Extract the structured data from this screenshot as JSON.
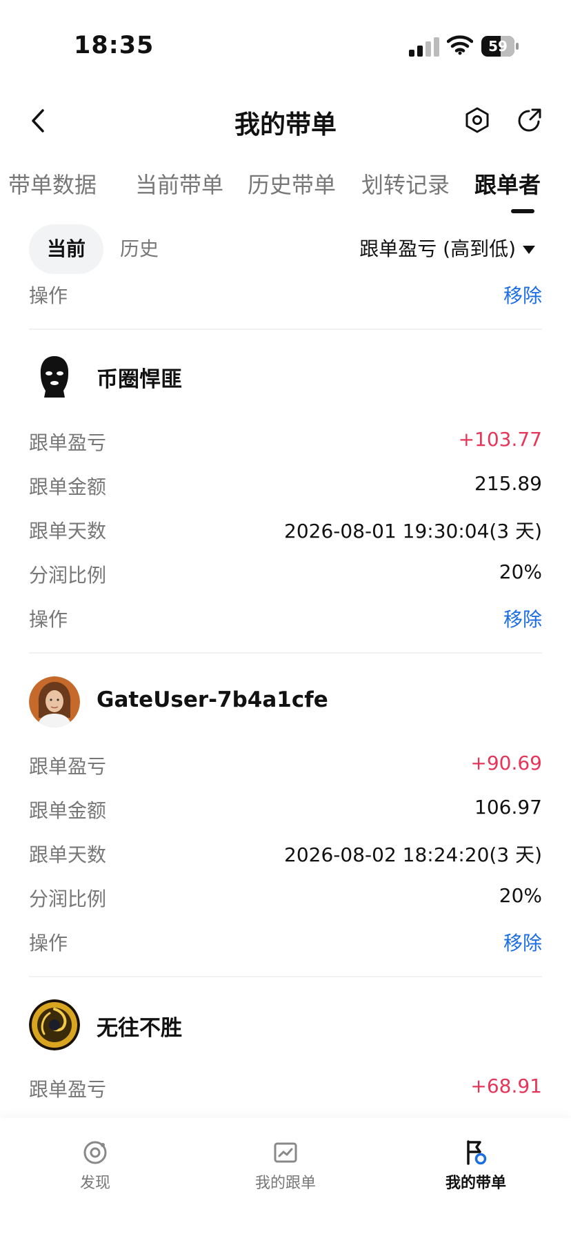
{
  "status_bar": {
    "time": "18:35",
    "battery": "59",
    "battery_level": 0.59
  },
  "header": {
    "title": "我的带单"
  },
  "tabs": [
    {
      "label": "带单数据"
    },
    {
      "label": "当前带单"
    },
    {
      "label": "历史带单"
    },
    {
      "label": "划转记录"
    },
    {
      "label": "跟单者"
    }
  ],
  "filter": {
    "current": "当前",
    "history": "历史",
    "sort_label": "跟单盈亏 (高到低)"
  },
  "top_action": {
    "label": "操作",
    "value": "移除"
  },
  "followers": [
    {
      "name": "币圈悍匪",
      "avatar_icon": "balaclava-avatar-icon",
      "rows": [
        {
          "label": "跟单盈亏",
          "value": "+103.77"
        },
        {
          "label": "跟单金额",
          "value": "215.89"
        },
        {
          "label": "跟单天数",
          "value": "2026-08-01 19:30:04(3 天)"
        },
        {
          "label": "分润比例",
          "value": "20%"
        },
        {
          "label": "操作",
          "value": "移除"
        }
      ]
    },
    {
      "name": "GateUser-7b4a1cfe",
      "avatar_icon": "person-photo-avatar-icon",
      "rows": [
        {
          "label": "跟单盈亏",
          "value": "+90.69"
        },
        {
          "label": "跟单金额",
          "value": "106.97"
        },
        {
          "label": "跟单天数",
          "value": "2026-08-02 18:24:20(3 天)"
        },
        {
          "label": "分润比例",
          "value": "20%"
        },
        {
          "label": "操作",
          "value": "移除"
        }
      ]
    },
    {
      "name": "无往不胜",
      "avatar_icon": "gold-emblem-avatar-icon",
      "rows": [
        {
          "label": "跟单盈亏",
          "value": "+68.91"
        }
      ]
    }
  ],
  "bottom_nav": [
    {
      "label": "发现",
      "icon": "discover-icon"
    },
    {
      "label": "我的跟单",
      "icon": "chart-icon"
    },
    {
      "label": "我的带单",
      "icon": "flag-icon"
    }
  ],
  "colors": {
    "positive": "#e5365a",
    "link": "#1c6ee0",
    "text_muted": "#777777"
  }
}
